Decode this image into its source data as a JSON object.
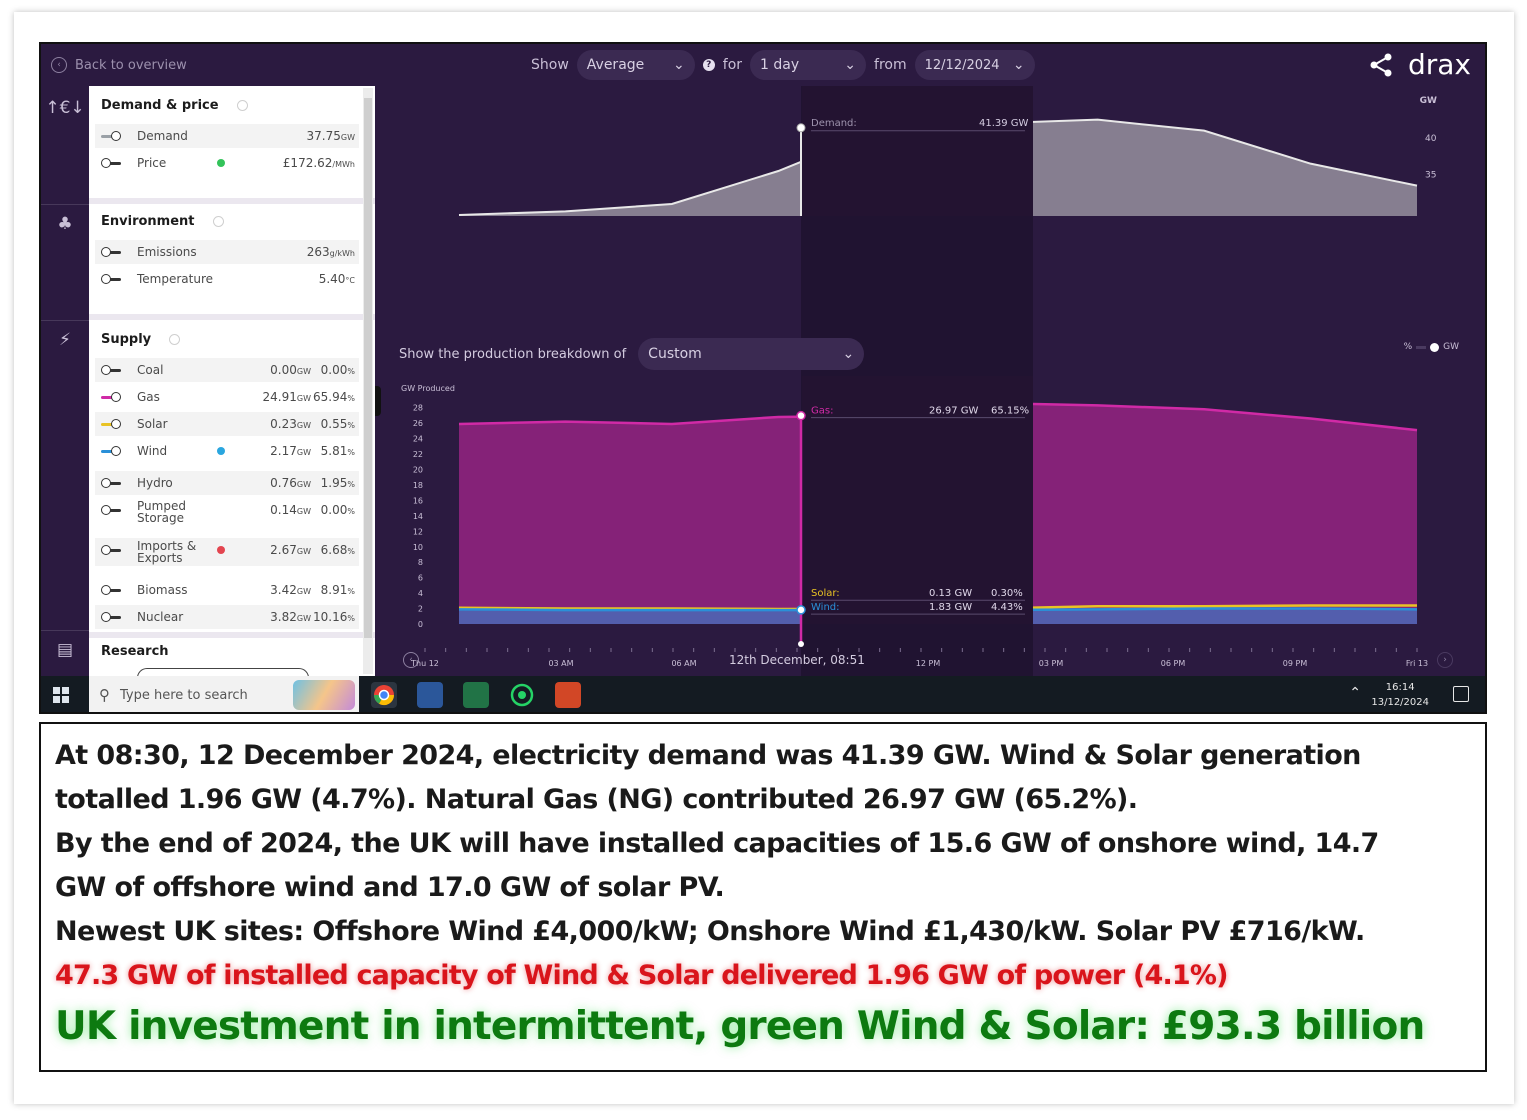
{
  "topbar": {
    "back_label": "Back to overview",
    "show_label": "Show",
    "show_value": "Average",
    "for_label": "for",
    "for_value": "1 day",
    "from_label": "from",
    "from_value": "12/12/2024",
    "brand": "drax"
  },
  "sidebar": {
    "demand_price": {
      "title": "Demand & price",
      "rows": [
        {
          "label": "Demand",
          "value": "37.75",
          "unit": "GW"
        },
        {
          "label": "Price",
          "value": "£172.62",
          "unit": "/MWh"
        }
      ]
    },
    "environment": {
      "title": "Environment",
      "rows": [
        {
          "label": "Emissions",
          "value": "263",
          "unit": "g/kWh"
        },
        {
          "label": "Temperature",
          "value": "5.40",
          "unit": "°C"
        }
      ]
    },
    "supply": {
      "title": "Supply",
      "rows": [
        {
          "label": "Coal",
          "gw": "0.00",
          "pct": "0.00"
        },
        {
          "label": "Gas",
          "gw": "24.91",
          "pct": "65.94"
        },
        {
          "label": "Solar",
          "gw": "0.23",
          "pct": "0.55"
        },
        {
          "label": "Wind",
          "gw": "2.17",
          "pct": "5.81"
        },
        {
          "label": "Hydro",
          "gw": "0.76",
          "pct": "1.95"
        },
        {
          "label": "Pumped",
          "label2": "Storage",
          "gw": "0.14",
          "pct": "0.00"
        },
        {
          "label": "Imports &",
          "label2": "Exports",
          "gw": "2.67",
          "pct": "6.68"
        },
        {
          "label": "Biomass",
          "gw": "3.42",
          "pct": "8.91"
        },
        {
          "label": "Nuclear",
          "gw": "3.82",
          "pct": "10.16"
        }
      ],
      "gw_unit": "GW",
      "pct_unit": "%"
    },
    "research": {
      "title": "Research"
    }
  },
  "chart": {
    "breakdown_label": "Show the production breakdown of",
    "breakdown_value": "Custom",
    "gw_produced_label": "GW Produced",
    "unit_toggle_pct": "%",
    "unit_toggle_gw": "GW",
    "demand_axis_unit": "GW",
    "cursor_label": "12th December, 08:51"
  },
  "chart_data": [
    {
      "type": "area",
      "x": [
        "Thu 12",
        "03 AM",
        "06 AM",
        "09 AM",
        "12 PM",
        "03 PM",
        "06 PM",
        "09 PM",
        "Fri 13"
      ],
      "yticks": [
        35,
        40
      ],
      "series": [
        {
          "name": "Demand",
          "values": [
            29.5,
            30,
            31,
            35.5,
            41.39,
            42,
            42.5,
            41,
            36.5,
            33.5
          ]
        }
      ],
      "tooltip": {
        "name": "Demand",
        "value": "41.39",
        "unit": "GW"
      },
      "colors": {
        "Demand": "#cfcfcf"
      }
    },
    {
      "type": "area",
      "x": [
        "Thu 12",
        "03 AM",
        "06 AM",
        "09 AM",
        "12 PM",
        "03 PM",
        "06 PM",
        "09 PM",
        "Fri 13"
      ],
      "ylabel": "GW Produced",
      "yticks": [
        0,
        2,
        4,
        6,
        8,
        10,
        12,
        14,
        16,
        18,
        20,
        22,
        24,
        26,
        28
      ],
      "ylim": [
        0,
        29
      ],
      "series": [
        {
          "name": "Gas",
          "values": [
            25.9,
            26.2,
            25.9,
            26.8,
            26.97,
            28.6,
            28.3,
            27.8,
            26.6,
            25.1
          ]
        },
        {
          "name": "Solar",
          "values": [
            2.1,
            2.0,
            2.0,
            1.95,
            1.96,
            2.0,
            2.3,
            2.3,
            2.4,
            2.4
          ]
        },
        {
          "name": "Wind",
          "values": [
            1.9,
            1.8,
            1.8,
            1.8,
            1.83,
            1.8,
            1.9,
            2.0,
            2.0,
            1.9
          ]
        }
      ],
      "tooltips": [
        {
          "name": "Gas",
          "gw": "26.97",
          "pct": "65.15"
        },
        {
          "name": "Solar",
          "gw": "0.13",
          "pct": "0.30"
        },
        {
          "name": "Wind",
          "gw": "1.83",
          "pct": "4.43"
        }
      ],
      "colors": {
        "Gas": "#d02aa6",
        "Solar": "#e9c324",
        "Wind": "#2a90d8"
      }
    }
  ],
  "taskbar": {
    "search_placeholder": "Type here to search",
    "time": "16:14",
    "date": "13/12/2024"
  },
  "caption": {
    "l1": "At 08:30, 12 December 2024, electricity demand was 41.39 GW. Wind & Solar generation",
    "l2": "totalled 1.96 GW (4.7%). Natural Gas (NG) contributed 26.97 GW (65.2%).",
    "l3": "By the end of 2024, the UK will have installed capacities of 15.6 GW of onshore wind, 14.7",
    "l4": "GW of offshore wind and 17.0 GW of solar PV.",
    "l5": "Newest UK sites: Offshore Wind £4,000/kW; Onshore Wind £1,430/kW. Solar PV £716/kW.",
    "red": "47.3 GW of installed capacity of Wind & Solar delivered 1.96 GW of power (4.1%)",
    "green": "UK investment in intermittent, green Wind & Solar: £93.3 billion"
  }
}
